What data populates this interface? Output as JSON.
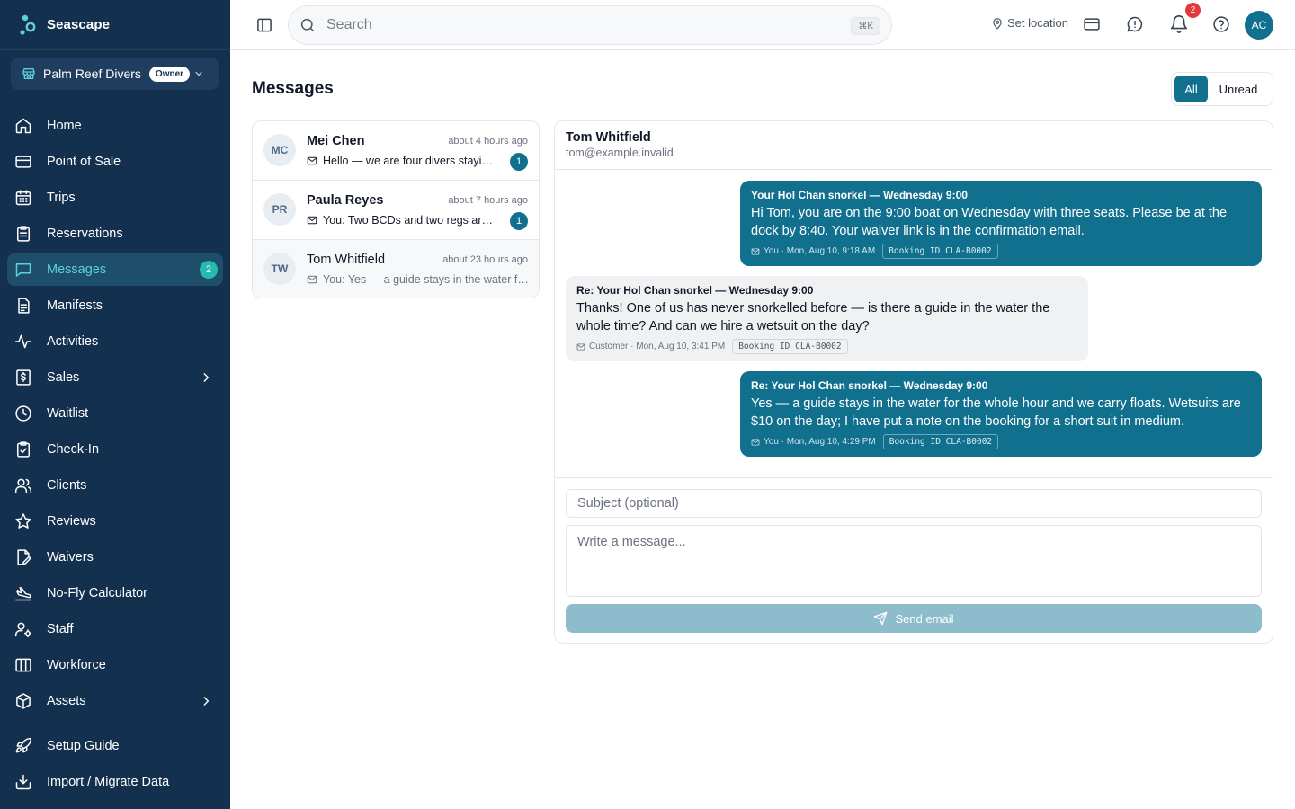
{
  "app": {
    "name": "Seascape"
  },
  "org": {
    "name": "Palm Reef Divers",
    "role": "Owner"
  },
  "nav": {
    "items": [
      {
        "label": "Home",
        "icon": "home-icon"
      },
      {
        "label": "Point of Sale",
        "icon": "credit-card-icon"
      },
      {
        "label": "Trips",
        "icon": "calendar-icon"
      },
      {
        "label": "Reservations",
        "icon": "clipboard-icon"
      },
      {
        "label": "Messages",
        "icon": "message-icon",
        "badge": "2",
        "active": true
      },
      {
        "label": "Manifests",
        "icon": "document-icon"
      },
      {
        "label": "Activities",
        "icon": "activity-icon"
      },
      {
        "label": "Sales",
        "icon": "receipt-icon",
        "has_submenu": true
      },
      {
        "label": "Waitlist",
        "icon": "clock-icon"
      },
      {
        "label": "Check-In",
        "icon": "clipboard-check-icon"
      },
      {
        "label": "Clients",
        "icon": "users-icon"
      },
      {
        "label": "Reviews",
        "icon": "star-icon"
      },
      {
        "label": "Waivers",
        "icon": "file-signature-icon"
      },
      {
        "label": "No-Fly Calculator",
        "icon": "plane-landing-icon"
      },
      {
        "label": "Staff",
        "icon": "user-cog-icon"
      },
      {
        "label": "Workforce",
        "icon": "columns-icon"
      },
      {
        "label": "Assets",
        "icon": "box-icon",
        "has_submenu": true
      }
    ],
    "bottom": [
      {
        "label": "Setup Guide",
        "icon": "rocket-icon"
      },
      {
        "label": "Import / Migrate Data",
        "icon": "import-icon"
      }
    ]
  },
  "topbar": {
    "search_placeholder": "Search",
    "shortcut": "⌘K",
    "location_label": "Set location",
    "notifications_count": "2",
    "avatar_initials": "AC"
  },
  "page": {
    "title": "Messages",
    "filters": {
      "all": "All",
      "unread": "Unread",
      "active": "All"
    }
  },
  "conversations": [
    {
      "initials": "MC",
      "name": "Mei Chen",
      "time": "about 4 hours ago",
      "preview": "Hello — we are four divers staying at the resort next week",
      "unread_count": "1",
      "unread": true
    },
    {
      "initials": "PR",
      "name": "Paula Reyes",
      "time": "about 7 hours ago",
      "preview": "You: Two BCDs and two regs are reserved for you",
      "unread_count": "1",
      "unread": true
    },
    {
      "initials": "TW",
      "name": "Tom Whitfield",
      "time": "about 23 hours ago",
      "preview": "You: Yes — a guide stays in the water for the whole hour",
      "unread": false,
      "selected": true
    }
  ],
  "thread": {
    "contact_name": "Tom Whitfield",
    "contact_email": "tom@example.invalid",
    "booking_label": "Booking ID",
    "messages": [
      {
        "direction": "outgoing",
        "subject": "Your Hol Chan snorkel — Wednesday 9:00",
        "body": "Hi Tom, you are on the 9:00 boat on Wednesday with three seats. Please be at the dock by 8:40. Your waiver link is in the confirmation email.",
        "sender": "You",
        "timestamp": "Mon, Aug 10, 9:18 AM",
        "booking_id": "CLA-B0002"
      },
      {
        "direction": "incoming",
        "subject": "Re: Your Hol Chan snorkel — Wednesday 9:00",
        "body": "Thanks! One of us has never snorkelled before — is there a guide in the water the whole time? And can we hire a wetsuit on the day?",
        "sender": "Customer",
        "timestamp": "Mon, Aug 10, 3:41 PM",
        "booking_id": "CLA-B0002"
      },
      {
        "direction": "outgoing",
        "subject": "Re: Your Hol Chan snorkel — Wednesday 9:00",
        "body": "Yes — a guide stays in the water for the whole hour and we carry floats. Wetsuits are $10 on the day; I have put a note on the booking for a short suit in medium.",
        "sender": "You",
        "timestamp": "Mon, Aug 10, 4:29 PM",
        "booking_id": "CLA-B0002"
      }
    ]
  },
  "compose": {
    "subject_placeholder": "Subject (optional)",
    "body_placeholder": "Write a message...",
    "send_label": "Send email"
  },
  "colors": {
    "sidebar": "#14304f",
    "accent": "#12708f",
    "active_text": "#5fd0d6",
    "badge_teal": "#2ab9b0",
    "notification_red": "#e23a3a"
  }
}
